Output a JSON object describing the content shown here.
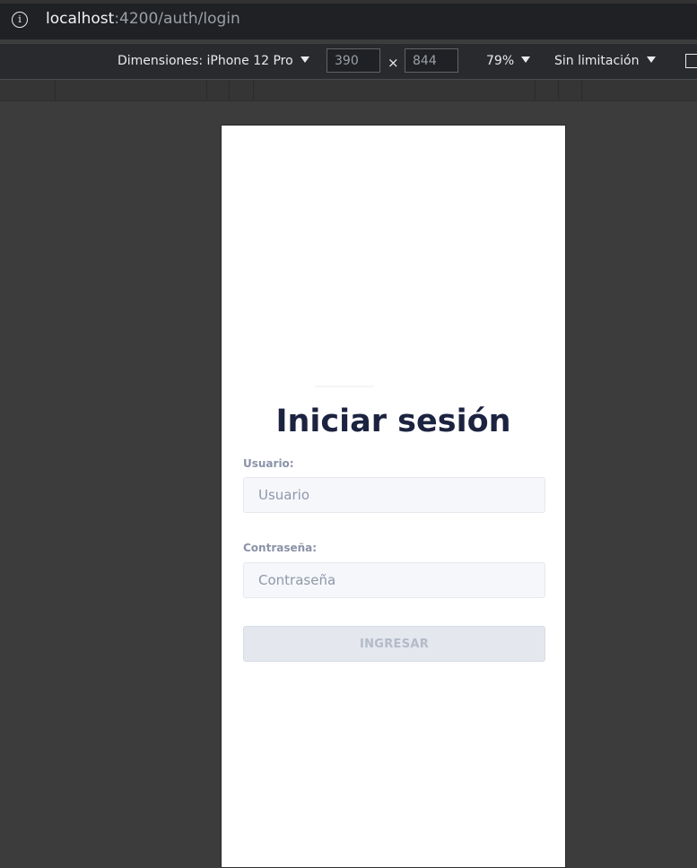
{
  "browser": {
    "url_host": "localhost",
    "url_rest": ":4200/auth/login"
  },
  "device_toolbar": {
    "dimensions_label": "Dimensiones: iPhone 12 Pro",
    "width": "390",
    "height": "844",
    "times": "×",
    "zoom": "79%",
    "throttling": "Sin limitación"
  },
  "login": {
    "title": "Iniciar sesión",
    "username_label": "Usuario:",
    "username_placeholder": "Usuario",
    "password_label": "Contraseña:",
    "password_placeholder": "Contraseña",
    "submit_label": "INGRESAR"
  }
}
